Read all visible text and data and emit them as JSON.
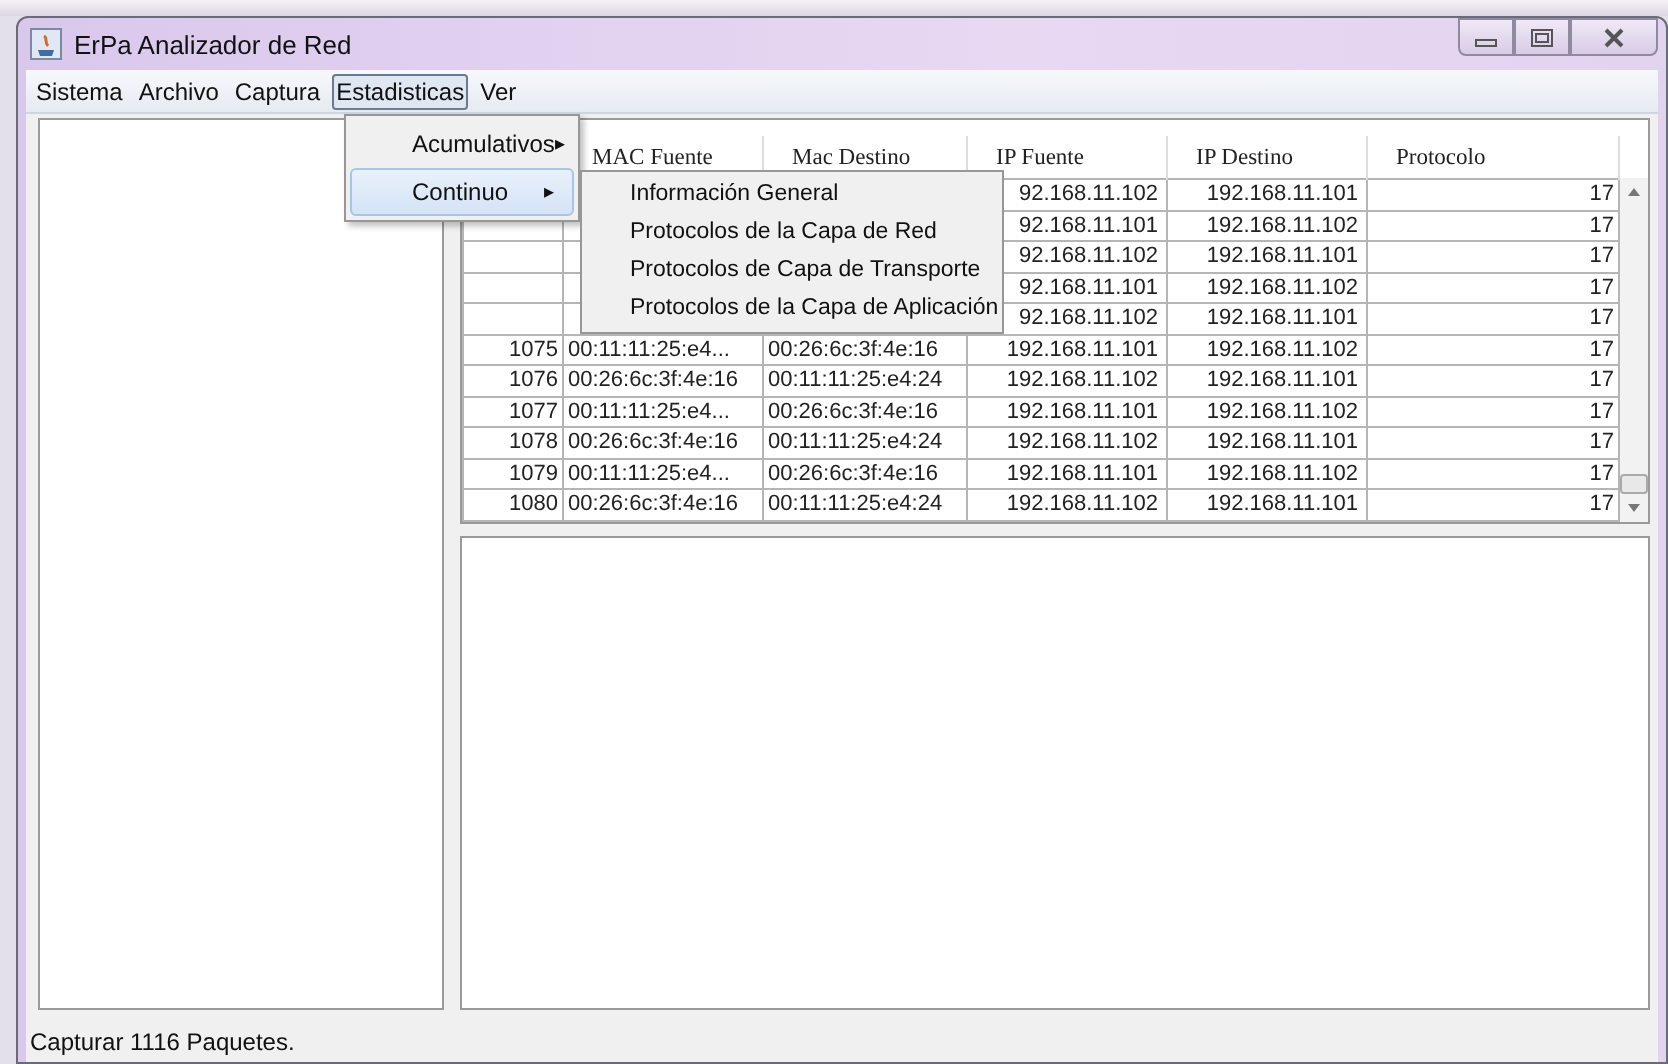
{
  "window": {
    "title": "ErPa Analizador de Red"
  },
  "menubar": [
    {
      "label": "Sistema",
      "selected": false
    },
    {
      "label": "Archivo",
      "selected": false
    },
    {
      "label": "Captura",
      "selected": false
    },
    {
      "label": "Estadisticas",
      "selected": true
    },
    {
      "label": "Ver",
      "selected": false
    }
  ],
  "dropdown": [
    {
      "label": "Acumulativos",
      "arrow": "▸",
      "selected": false
    },
    {
      "label": "Continuo",
      "arrow": "▸",
      "selected": true
    }
  ],
  "submenu": [
    "Información General",
    "Protocolos de la Capa de Red",
    "Protocolos de Capa de Transporte",
    "Protocolos de la Capa de Aplicación"
  ],
  "table": {
    "columns": [
      "MAC Fuente",
      "Mac Destino",
      "IP Fuente",
      "IP Destino",
      "Protocolo"
    ],
    "rows": [
      {
        "ip_src": "92.168.11.102",
        "ip_dst": "192.168.11.101",
        "protocol": "17"
      },
      {
        "ip_src": "92.168.11.101",
        "ip_dst": "192.168.11.102",
        "protocol": "17"
      },
      {
        "ip_src": "92.168.11.102",
        "ip_dst": "192.168.11.101",
        "protocol": "17"
      },
      {
        "ip_src": "92.168.11.101",
        "ip_dst": "192.168.11.102",
        "protocol": "17"
      },
      {
        "ip_src": "92.168.11.102",
        "ip_dst": "192.168.11.101",
        "protocol": "17"
      },
      {
        "number": "1075",
        "mac_src": "00:11:11:25:e4...",
        "mac_dst": "00:26:6c:3f:4e:16",
        "ip_src": "192.168.11.101",
        "ip_dst": "192.168.11.102",
        "protocol": "17"
      },
      {
        "number": "1076",
        "mac_src": "00:26:6c:3f:4e:16",
        "mac_dst": "00:11:11:25:e4:24",
        "ip_src": "192.168.11.102",
        "ip_dst": "192.168.11.101",
        "protocol": "17"
      },
      {
        "number": "1077",
        "mac_src": "00:11:11:25:e4...",
        "mac_dst": "00:26:6c:3f:4e:16",
        "ip_src": "192.168.11.101",
        "ip_dst": "192.168.11.102",
        "protocol": "17"
      },
      {
        "number": "1078",
        "mac_src": "00:26:6c:3f:4e:16",
        "mac_dst": "00:11:11:25:e4:24",
        "ip_src": "192.168.11.102",
        "ip_dst": "192.168.11.101",
        "protocol": "17"
      },
      {
        "number": "1079",
        "mac_src": "00:11:11:25:e4...",
        "mac_dst": "00:26:6c:3f:4e:16",
        "ip_src": "192.168.11.101",
        "ip_dst": "192.168.11.102",
        "protocol": "17"
      },
      {
        "number": "1080",
        "mac_src": "00:26:6c:3f:4e:16",
        "mac_dst": "00:11:11:25:e4:24",
        "ip_src": "192.168.11.102",
        "ip_dst": "192.168.11.101",
        "protocol": "17"
      }
    ]
  },
  "status_bar": "Capturar 1116 Paquetes."
}
